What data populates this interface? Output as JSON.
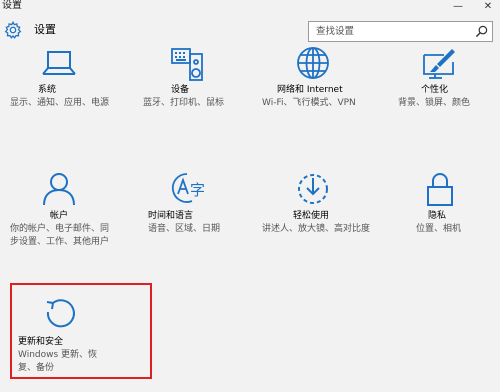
{
  "window": {
    "title": "设置",
    "min_glyph": "—",
    "close_glyph": "✕"
  },
  "header": {
    "title": "设置",
    "search_placeholder": "查找设置"
  },
  "tiles": [
    {
      "name": "系统",
      "desc": "显示、通知、应用、电源",
      "icon": "laptop-icon"
    },
    {
      "name": "设备",
      "desc": "蓝牙、打印机、鼠标",
      "icon": "keyboard-speaker-icon"
    },
    {
      "name": "网络和 Internet",
      "desc": "Wi-Fi、飞行模式、VPN",
      "icon": "globe-icon"
    },
    {
      "name": "个性化",
      "desc": "背景、锁屏、颜色",
      "icon": "brush-monitor-icon"
    },
    {
      "name": "帐户",
      "desc": "你的帐户、电子邮件、同步设置、工作、其他用户",
      "icon": "person-icon"
    },
    {
      "name": "时间和语言",
      "desc": "语音、区域、日期",
      "icon": "time-language-icon"
    },
    {
      "name": "轻松使用",
      "desc": "讲述人、放大镜、高对比度",
      "icon": "ease-of-access-icon"
    },
    {
      "name": "隐私",
      "desc": "位置、相机",
      "icon": "lock-icon"
    },
    {
      "name": "更新和安全",
      "desc": "Windows 更新、恢复、备份",
      "icon": "refresh-icon"
    }
  ],
  "colors": {
    "accent": "#1e72c5",
    "highlight_border": "#e02020",
    "background": "#f2f2f2"
  }
}
